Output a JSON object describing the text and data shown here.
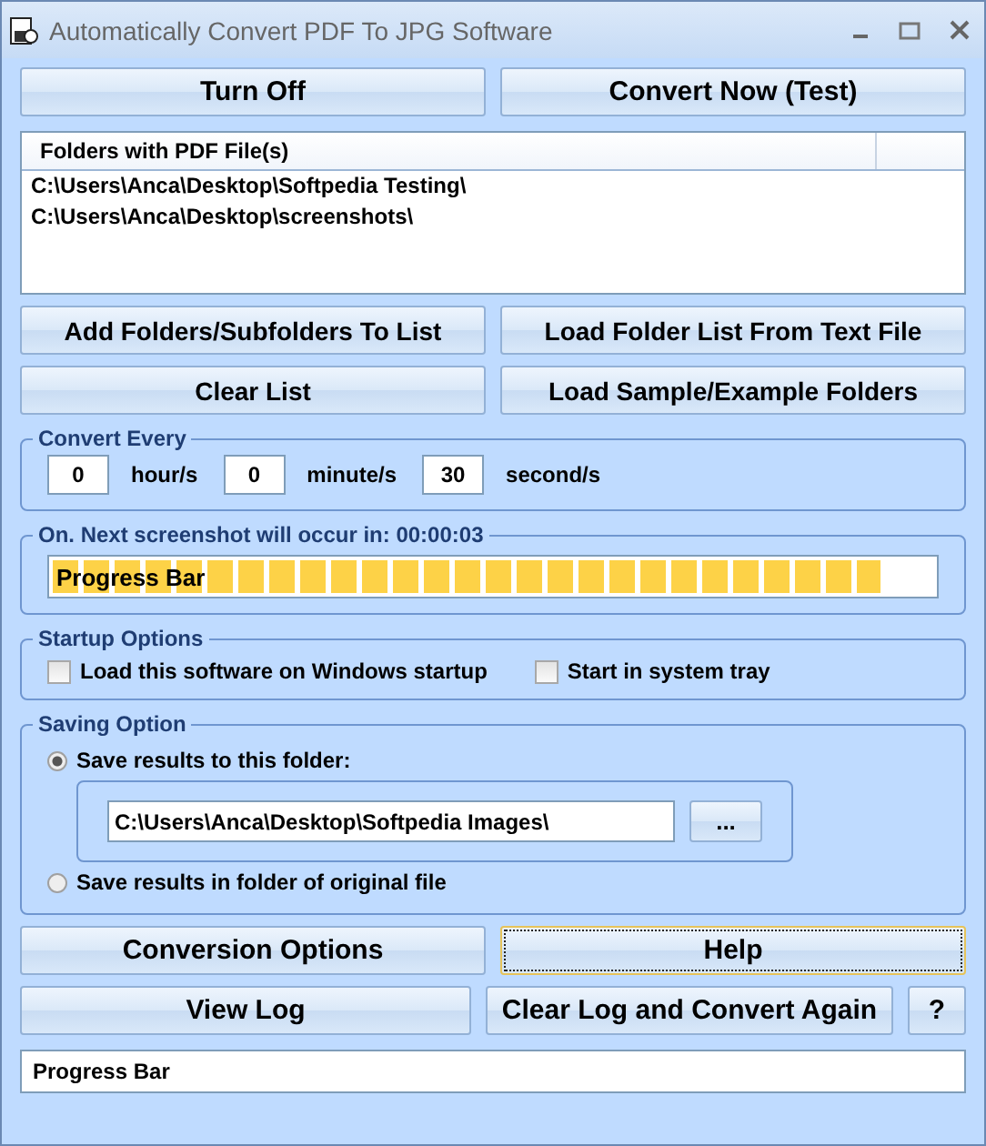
{
  "window": {
    "title": "Automatically Convert PDF To JPG Software"
  },
  "top_buttons": [
    "Turn Off",
    "Convert Now (Test)"
  ],
  "folder_list": {
    "column": "Folders with PDF File(s)",
    "rows": [
      "C:\\Users\\Anca\\Desktop\\Softpedia Testing\\",
      "C:\\Users\\Anca\\Desktop\\screenshots\\"
    ]
  },
  "list_buttons": [
    "Add Folders/Subfolders To List",
    "Load Folder List From Text File",
    "Clear List",
    "Load Sample/Example Folders"
  ],
  "convert_every": {
    "title": "Convert Every",
    "fields": [
      {
        "value": "0",
        "unit": "hour/s"
      },
      {
        "value": "0",
        "unit": "minute/s"
      },
      {
        "value": "30",
        "unit": "second/s"
      }
    ]
  },
  "progress": {
    "title": "On. Next screenshot will occur in: 00:00:03",
    "label": "Progress Bar",
    "level": 0.94
  },
  "startup_options": {
    "title": "Startup Options",
    "options": [
      {
        "label": "Load this software on Windows startup",
        "checked": false
      },
      {
        "label": "Start in system tray",
        "checked": false
      }
    ]
  },
  "saving_option": {
    "title": "Saving Option",
    "choices": [
      {
        "label": "Save results to this folder:",
        "selected": true
      },
      {
        "label": "Save results in folder of original file",
        "selected": false
      }
    ],
    "folder": "C:\\Users\\Anca\\Desktop\\Softpedia Images\\",
    "browse": "..."
  },
  "bottom_buttons": [
    {
      "label": "Conversion Options",
      "focused": false
    },
    {
      "label": "Help",
      "focused": true
    }
  ],
  "log_buttons": [
    "View Log",
    "Clear Log and Convert Again",
    "?"
  ],
  "status_bar": "Progress Bar"
}
